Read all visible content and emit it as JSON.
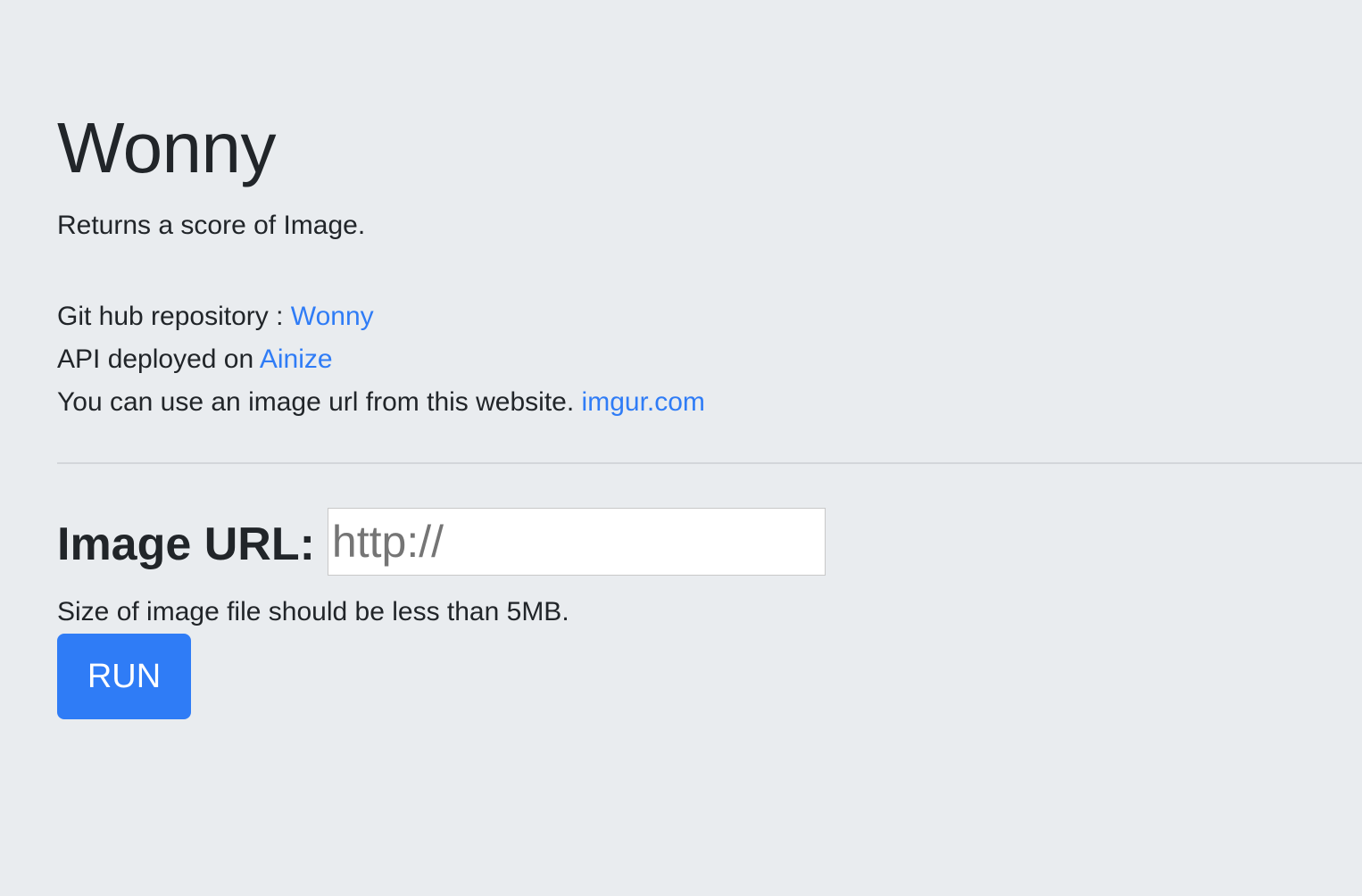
{
  "header": {
    "title": "Wonny",
    "lead": "Returns a score of Image."
  },
  "info": {
    "repo_prefix": "Git hub repository : ",
    "repo_link": "Wonny",
    "api_prefix": "API deployed on ",
    "api_link": "Ainize",
    "imgur_prefix": "You can use an image url from this website. ",
    "imgur_link": "imgur.com"
  },
  "form": {
    "url_label": "Image URL:",
    "url_placeholder": "http://",
    "url_value": "",
    "size_note": "Size of image file should be less than 5MB.",
    "run_label": "RUN"
  },
  "colors": {
    "background": "#e9ecef",
    "text": "#212529",
    "link": "#2f7cf6",
    "button": "#2f7cf6"
  }
}
